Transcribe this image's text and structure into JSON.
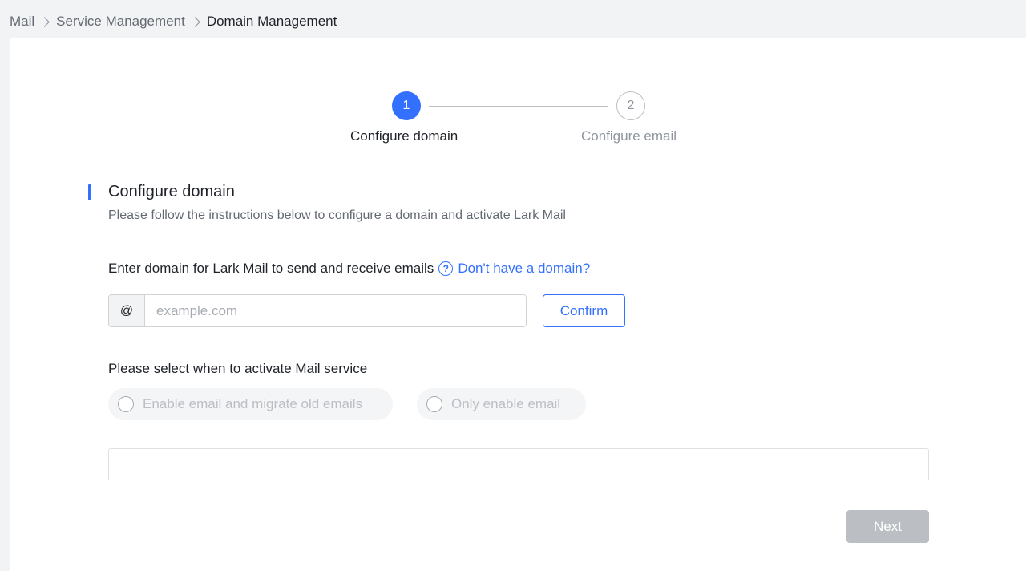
{
  "breadcrumb": {
    "items": [
      "Mail",
      "Service Management",
      "Domain Management"
    ]
  },
  "stepper": {
    "steps": [
      {
        "number": "1",
        "label": "Configure domain",
        "state": "active"
      },
      {
        "number": "2",
        "label": "Configure email",
        "state": "pending"
      }
    ]
  },
  "section": {
    "title": "Configure domain",
    "description": "Please follow the instructions below to configure a domain and activate Lark Mail"
  },
  "domain_field": {
    "label": "Enter domain for Lark Mail to send and receive emails",
    "help_icon": "question-circle-icon",
    "help_link": "Don't have a domain?",
    "prefix": "@",
    "placeholder": "example.com",
    "value": "",
    "confirm_label": "Confirm"
  },
  "activation": {
    "label": "Please select when to activate Mail service",
    "options": [
      {
        "label": "Enable email and migrate old emails",
        "selected": false,
        "disabled": true
      },
      {
        "label": "Only enable email",
        "selected": false,
        "disabled": true
      }
    ]
  },
  "footer": {
    "next_label": "Next"
  },
  "colors": {
    "accent": "#3370ff",
    "disabled": "#bbbfc4"
  }
}
